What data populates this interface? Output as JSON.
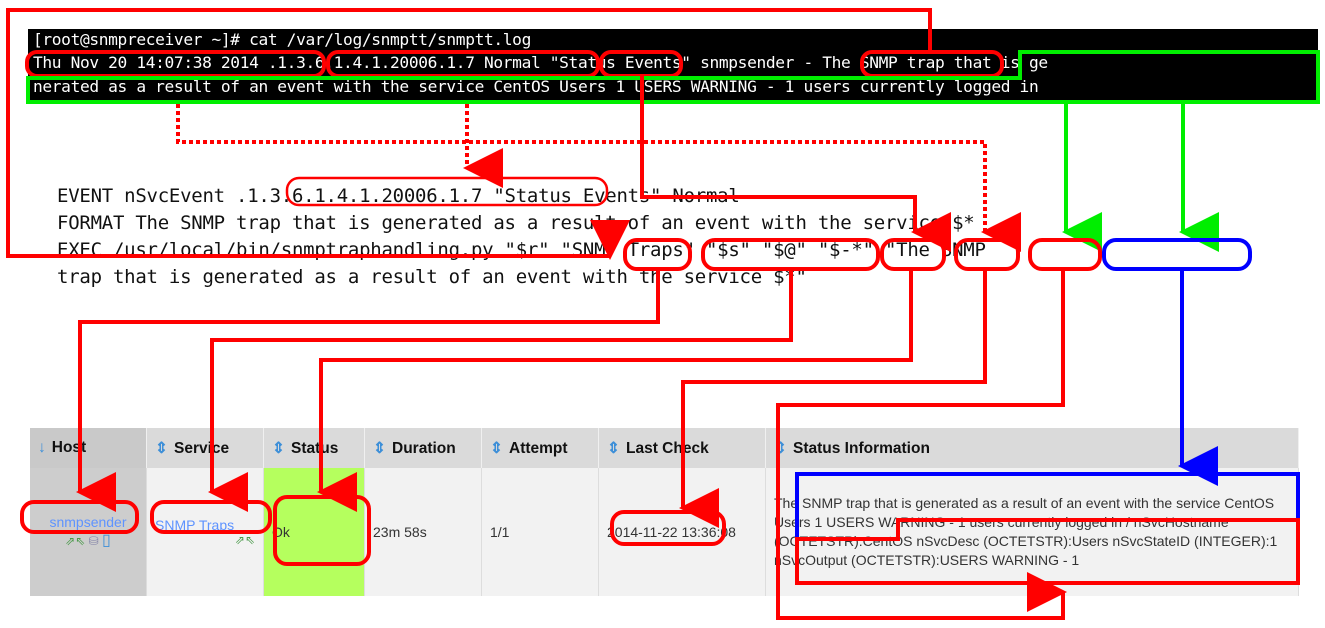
{
  "terminal": {
    "prompt_line": "[root@snmpreceiver ~]# cat /var/log/snmptt/snmptt.log",
    "log_line_1": "Thu Nov 20 14:07:38 2014 .1.3.6.1.4.1.20006.1.7 Normal \"Status Events\" snmpsender - The SNMP trap that is ge",
    "log_line_2": "nerated as a result of an event with the service CentOS Users 1 USERS WARNING - 1 users currently logged in"
  },
  "config": {
    "line_1": "EVENT nSvcEvent .1.3.6.1.4.1.20006.1.7 \"Status Events\" Normal",
    "line_2": "FORMAT The SNMP trap that is generated as a result of an event with the service $*",
    "line_3": "EXEC /usr/local/bin/snmptraphandling.py \"$r\" \"SNMP Traps\" \"$s\" \"$@\" \"$-*\" \"The SNMP",
    "line_4": "trap that is generated as a result of an event with the service $*\""
  },
  "table": {
    "headers": [
      {
        "sort_icon": "↓",
        "label": "Host"
      },
      {
        "sort_icon": "⇕",
        "label": "Service"
      },
      {
        "sort_icon": "⇕",
        "label": "Status"
      },
      {
        "sort_icon": "⇕",
        "label": "Duration"
      },
      {
        "sort_icon": "⇕",
        "label": "Attempt"
      },
      {
        "sort_icon": "⇕",
        "label": "Last Check"
      },
      {
        "sort_icon": "⇕",
        "label": "Status Information"
      }
    ],
    "row": {
      "host": "snmpsender",
      "service": "SNMP Traps",
      "status": "Ok",
      "duration": "23m 58s",
      "attempt": "1/1",
      "last_check": "2014-11-22 13:36:08",
      "status_info": "The SNMP trap that is generated as a result of an event with the service CentOS Users 1 USERS WARNING - 1 users currently logged in / nSvcHostname (OCTETSTR):CentOS nSvcDesc (OCTETSTR):Users nSvcStateID (INTEGER):1 nSvcOutput (OCTETSTR):USERS WARNING - 1"
    },
    "host_icons": [
      "passive-check-icon",
      "network-icon",
      "document-icon"
    ],
    "service_icons": [
      "passive-check-icon"
    ]
  },
  "colors": {
    "annotation_red": "#ff0000",
    "annotation_green": "#00ee00",
    "annotation_blue": "#0000ff",
    "status_ok": "#b5ff5e",
    "link": "#5e93ff"
  }
}
